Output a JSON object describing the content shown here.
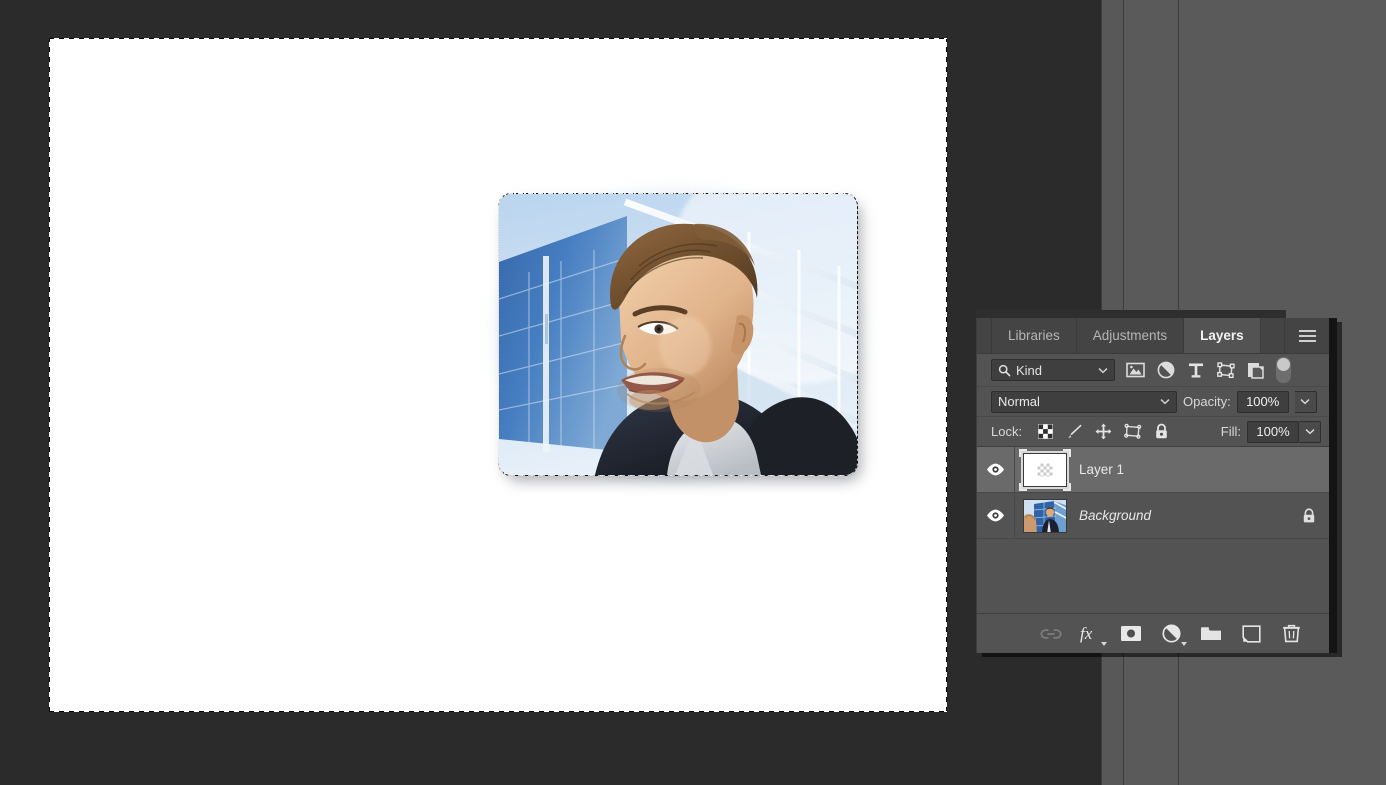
{
  "app": {
    "theme_bg": "#2b2b2b",
    "panel_bg": "#535353",
    "accent": "#6a6a6a"
  },
  "document": {
    "canvas_label": "document-canvas",
    "selection_active": true,
    "selection_label": "floating-pasted-selection",
    "selection_description": "Photo of a smiling man in dark jacket in front of a blue glass office building"
  },
  "layers_panel": {
    "tabs": [
      {
        "label": "Libraries",
        "active": false
      },
      {
        "label": "Adjustments",
        "active": false
      },
      {
        "label": "Layers",
        "active": true
      }
    ],
    "menu_icon": "hamburger-menu-icon",
    "filter": {
      "kind_label": "Kind",
      "search_icon": "search-icon",
      "chevron_icon": "chevron-down-icon",
      "icons": [
        {
          "name": "filter-pixel-layers-icon",
          "title": "Filter for pixel layers"
        },
        {
          "name": "filter-adjustment-layers-icon",
          "title": "Filter for adjustment layers"
        },
        {
          "name": "filter-type-layers-icon",
          "title": "Filter for type layers"
        },
        {
          "name": "filter-shape-layers-icon",
          "title": "Filter for shape layers"
        },
        {
          "name": "filter-smart-object-icon",
          "title": "Filter for smart objects"
        }
      ],
      "toggle_name": "filter-enable-toggle"
    },
    "blend": {
      "mode": "Normal",
      "opacity_label": "Opacity:",
      "opacity_value": "100%"
    },
    "lock": {
      "label": "Lock:",
      "icons": [
        {
          "name": "lock-transparent-pixels-icon",
          "title": "Lock transparent pixels"
        },
        {
          "name": "lock-image-pixels-icon",
          "title": "Lock image pixels"
        },
        {
          "name": "lock-position-icon",
          "title": "Lock position"
        },
        {
          "name": "lock-artboard-nesting-icon",
          "title": "Prevent auto-nesting"
        },
        {
          "name": "lock-all-icon",
          "title": "Lock all"
        }
      ],
      "fill_label": "Fill:",
      "fill_value": "100%"
    },
    "layers": [
      {
        "name": "Layer 1",
        "visible": true,
        "selected": true,
        "italic": false,
        "locked": false,
        "thumb_type": "transparent"
      },
      {
        "name": "Background",
        "visible": true,
        "selected": false,
        "italic": true,
        "locked": true,
        "thumb_type": "photo"
      }
    ],
    "footer_buttons": [
      {
        "name": "link-layers-button",
        "icon": "link-icon",
        "disabled": true
      },
      {
        "name": "layer-style-button",
        "icon": "fx-icon",
        "disabled": false,
        "caret": true
      },
      {
        "name": "add-layer-mask-button",
        "icon": "layer-mask-icon",
        "disabled": false
      },
      {
        "name": "new-fill-adjustment-button",
        "icon": "half-circle-icon",
        "disabled": false,
        "caret": true
      },
      {
        "name": "new-group-button",
        "icon": "folder-icon",
        "disabled": false
      },
      {
        "name": "new-layer-button",
        "icon": "new-layer-icon",
        "disabled": false
      },
      {
        "name": "delete-layer-button",
        "icon": "trash-icon",
        "disabled": false
      }
    ]
  }
}
